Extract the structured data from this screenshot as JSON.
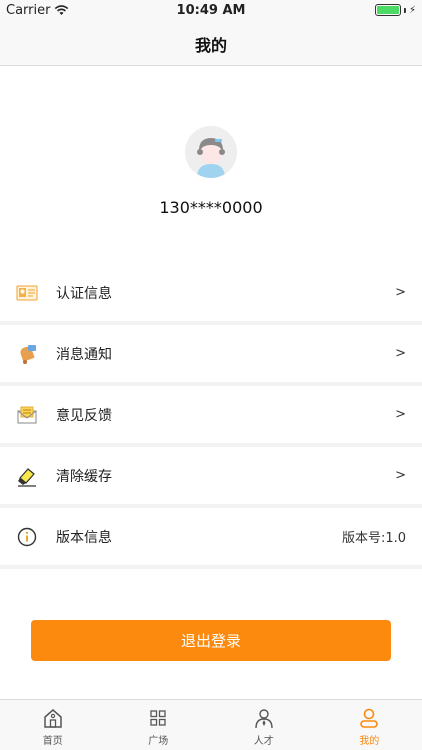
{
  "status_bar": {
    "carrier": "Carrier",
    "time": "10:49 AM",
    "battery_level": 1.0
  },
  "nav": {
    "title": "我的"
  },
  "profile": {
    "phone": "130****0000"
  },
  "menu": {
    "items": [
      {
        "label": "认证信息",
        "right": ">",
        "icon": "id-card-icon"
      },
      {
        "label": "消息通知",
        "right": ">",
        "icon": "bell-icon"
      },
      {
        "label": "意见反馈",
        "right": ">",
        "icon": "envelope-icon"
      },
      {
        "label": "清除缓存",
        "right": ">",
        "icon": "eraser-icon"
      },
      {
        "label": "版本信息",
        "right": "版本号:1.0",
        "icon": "info-icon"
      }
    ]
  },
  "logout": {
    "label": "退出登录"
  },
  "tabs": [
    {
      "label": "首页",
      "icon": "home-icon",
      "active": false
    },
    {
      "label": "广场",
      "icon": "grid-icon",
      "active": false
    },
    {
      "label": "人才",
      "icon": "person-pin-icon",
      "active": false
    },
    {
      "label": "我的",
      "icon": "user-icon",
      "active": true
    }
  ],
  "colors": {
    "accent": "#fb8a0f",
    "bar_background": "#f8f8f8",
    "divider": "#f2f2f2"
  }
}
